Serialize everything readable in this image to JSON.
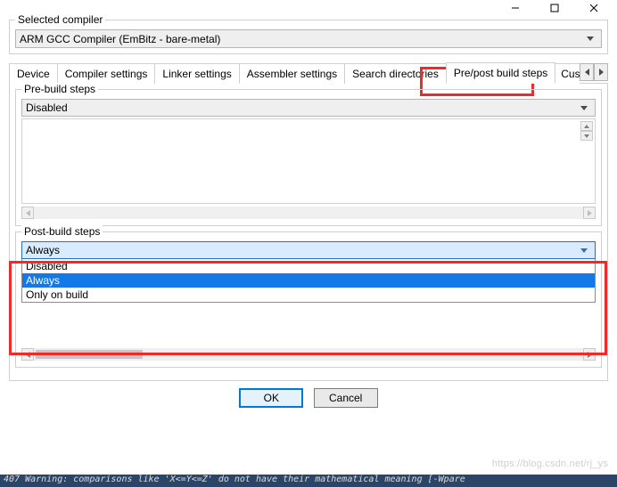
{
  "titlebar": {
    "min": "—",
    "max": "☐",
    "close": "✕"
  },
  "compiler_group": {
    "title": "Selected compiler",
    "value": "ARM GCC Compiler (EmBitz - bare-metal)"
  },
  "tabs": {
    "items": [
      "Device",
      "Compiler settings",
      "Linker settings",
      "Assembler settings",
      "Search directories",
      "Pre/post build steps"
    ],
    "partial": "Custom v",
    "active_index": 5
  },
  "pre_build": {
    "title": "Pre-build steps",
    "combo_value": "Disabled"
  },
  "post_build": {
    "title": "Post-build steps",
    "combo_value": "Always",
    "options": [
      "Disabled",
      "Always",
      "Only on build"
    ],
    "selected_index": 1
  },
  "buttons": {
    "ok": "OK",
    "cancel": "Cancel"
  },
  "watermark": "https://blog.csdn.net/rj_ys",
  "bottom_strip": "407    Warning: comparisons like 'X<=Y<=Z' do not have their mathematical meaning [-Wpare"
}
